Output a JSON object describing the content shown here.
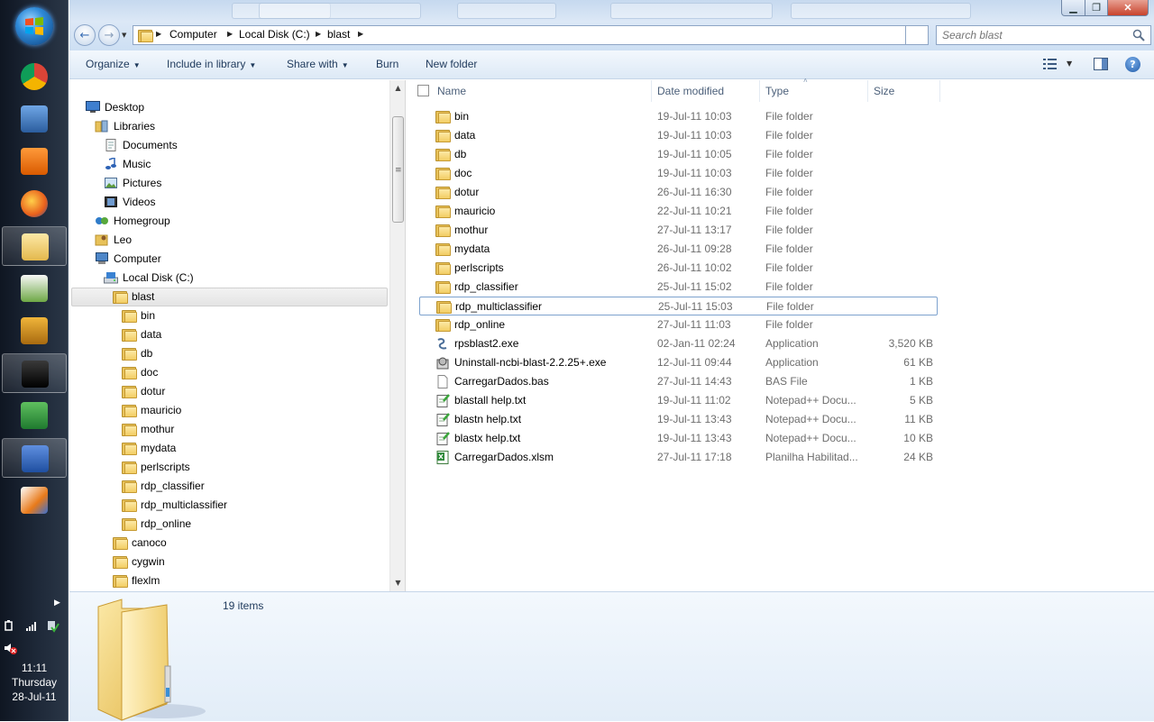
{
  "taskbar": {
    "apps": [
      {
        "name": "chrome",
        "active": false
      },
      {
        "name": "laptop",
        "active": false
      },
      {
        "name": "media-player",
        "active": false
      },
      {
        "name": "firefox",
        "active": false
      },
      {
        "name": "explorer",
        "active": true
      },
      {
        "name": "sigmaplot",
        "active": false
      },
      {
        "name": "elephant",
        "active": false
      },
      {
        "name": "terminal",
        "active": true
      },
      {
        "name": "excel",
        "active": false
      },
      {
        "name": "word",
        "active": true
      },
      {
        "name": "tool",
        "active": false
      }
    ],
    "clock": {
      "time": "11:11",
      "day": "Thursday",
      "date": "28-Jul-11"
    }
  },
  "window": {
    "breadcrumb": [
      "Computer",
      "Local Disk (C:)",
      "blast"
    ],
    "search_placeholder": "Search blast",
    "toolbar": {
      "organize": "Organize",
      "include": "Include in library",
      "share": "Share with",
      "burn": "Burn",
      "new_folder": "New folder"
    }
  },
  "nav": {
    "items": [
      {
        "label": "Desktop",
        "icon": "desktop-icon",
        "indent": 0
      },
      {
        "label": "Libraries",
        "icon": "libraries-icon",
        "indent": 1
      },
      {
        "label": "Documents",
        "icon": "documents-icon",
        "indent": 2
      },
      {
        "label": "Music",
        "icon": "music-icon",
        "indent": 2
      },
      {
        "label": "Pictures",
        "icon": "pictures-icon",
        "indent": 2
      },
      {
        "label": "Videos",
        "icon": "videos-icon",
        "indent": 2
      },
      {
        "label": "Homegroup",
        "icon": "homegroup-icon",
        "indent": 1
      },
      {
        "label": "Leo",
        "icon": "user-folder-icon",
        "indent": 1
      },
      {
        "label": "Computer",
        "icon": "computer-icon",
        "indent": 1
      },
      {
        "label": "Local Disk (C:)",
        "icon": "drive-icon",
        "indent": 2
      },
      {
        "label": "blast",
        "icon": "folder-icon",
        "indent": 3,
        "selected": true
      },
      {
        "label": "bin",
        "icon": "folder-icon",
        "indent": 4
      },
      {
        "label": "data",
        "icon": "folder-icon",
        "indent": 4
      },
      {
        "label": "db",
        "icon": "folder-icon",
        "indent": 4
      },
      {
        "label": "doc",
        "icon": "folder-icon",
        "indent": 4
      },
      {
        "label": "dotur",
        "icon": "folder-icon",
        "indent": 4
      },
      {
        "label": "mauricio",
        "icon": "folder-icon",
        "indent": 4
      },
      {
        "label": "mothur",
        "icon": "folder-icon",
        "indent": 4
      },
      {
        "label": "mydata",
        "icon": "folder-icon",
        "indent": 4
      },
      {
        "label": "perlscripts",
        "icon": "folder-icon",
        "indent": 4
      },
      {
        "label": "rdp_classifier",
        "icon": "folder-icon",
        "indent": 4
      },
      {
        "label": "rdp_multiclassifier",
        "icon": "folder-icon",
        "indent": 4
      },
      {
        "label": "rdp_online",
        "icon": "folder-icon",
        "indent": 4
      },
      {
        "label": "canoco",
        "icon": "folder-icon",
        "indent": 3
      },
      {
        "label": "cygwin",
        "icon": "folder-icon",
        "indent": 3
      },
      {
        "label": "flexlm",
        "icon": "folder-icon",
        "indent": 3
      }
    ]
  },
  "files": {
    "columns": {
      "name": "Name",
      "date": "Date modified",
      "type": "Type",
      "size": "Size"
    },
    "rows": [
      {
        "name": "bin",
        "date": "19-Jul-11 10:03",
        "type": "File folder",
        "size": "",
        "icon": "folder-icon"
      },
      {
        "name": "data",
        "date": "19-Jul-11 10:03",
        "type": "File folder",
        "size": "",
        "icon": "folder-icon"
      },
      {
        "name": "db",
        "date": "19-Jul-11 10:05",
        "type": "File folder",
        "size": "",
        "icon": "folder-icon"
      },
      {
        "name": "doc",
        "date": "19-Jul-11 10:03",
        "type": "File folder",
        "size": "",
        "icon": "folder-icon"
      },
      {
        "name": "dotur",
        "date": "26-Jul-11 16:30",
        "type": "File folder",
        "size": "",
        "icon": "folder-icon"
      },
      {
        "name": "mauricio",
        "date": "22-Jul-11 10:21",
        "type": "File folder",
        "size": "",
        "icon": "folder-icon"
      },
      {
        "name": "mothur",
        "date": "27-Jul-11 13:17",
        "type": "File folder",
        "size": "",
        "icon": "folder-icon"
      },
      {
        "name": "mydata",
        "date": "26-Jul-11 09:28",
        "type": "File folder",
        "size": "",
        "icon": "folder-icon"
      },
      {
        "name": "perlscripts",
        "date": "26-Jul-11 10:02",
        "type": "File folder",
        "size": "",
        "icon": "folder-icon"
      },
      {
        "name": "rdp_classifier",
        "date": "25-Jul-11 15:02",
        "type": "File folder",
        "size": "",
        "icon": "folder-icon"
      },
      {
        "name": "rdp_multiclassifier",
        "date": "25-Jul-11 15:03",
        "type": "File folder",
        "size": "",
        "icon": "folder-icon",
        "focused": true
      },
      {
        "name": "rdp_online",
        "date": "27-Jul-11 11:03",
        "type": "File folder",
        "size": "",
        "icon": "folder-icon"
      },
      {
        "name": "rpsblast2.exe",
        "date": "02-Jan-11 02:24",
        "type": "Application",
        "size": "3,520 KB",
        "icon": "exe-icon"
      },
      {
        "name": "Uninstall-ncbi-blast-2.2.25+.exe",
        "date": "12-Jul-11 09:44",
        "type": "Application",
        "size": "61 KB",
        "icon": "installer-icon"
      },
      {
        "name": "CarregarDados.bas",
        "date": "27-Jul-11 14:43",
        "type": "BAS File",
        "size": "1 KB",
        "icon": "blank-file-icon"
      },
      {
        "name": "blastall help.txt",
        "date": "19-Jul-11 11:02",
        "type": "Notepad++ Docu...",
        "size": "5 KB",
        "icon": "notepad-icon"
      },
      {
        "name": "blastn help.txt",
        "date": "19-Jul-11 13:43",
        "type": "Notepad++ Docu...",
        "size": "11 KB",
        "icon": "notepad-icon"
      },
      {
        "name": "blastx help.txt",
        "date": "19-Jul-11 13:43",
        "type": "Notepad++ Docu...",
        "size": "10 KB",
        "icon": "notepad-icon"
      },
      {
        "name": "CarregarDados.xlsm",
        "date": "27-Jul-11 17:18",
        "type": "Planilha Habilitad...",
        "size": "24 KB",
        "icon": "excel-file-icon"
      }
    ]
  },
  "details": {
    "item_count": "19 items"
  }
}
